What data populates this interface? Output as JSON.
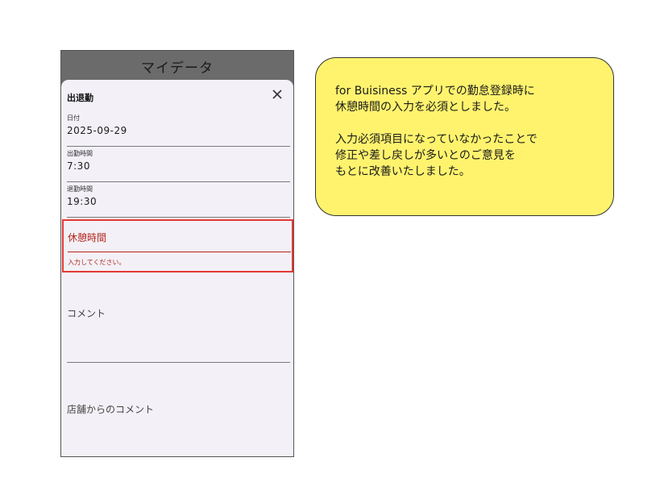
{
  "header": {
    "title": "マイデータ"
  },
  "sheet": {
    "title": "出退勤",
    "fields": {
      "date": {
        "label": "日付",
        "value": "2025-09-29"
      },
      "start": {
        "label": "出勤時間",
        "value": "7:30"
      },
      "end": {
        "label": "退勤時間",
        "value": "19:30"
      }
    },
    "break_time": {
      "label": "休憩時間",
      "error": "入力してください。"
    },
    "comment_label": "コメント",
    "store_comment_label": "店舗からのコメント"
  },
  "note": {
    "lines_1": [
      "for Buisiness アプリでの勤怠登録時に",
      "休憩時間の入力を必須としました。"
    ],
    "lines_2": [
      "入力必須項目になっていなかったことで",
      "修正や差し戻しが多いとのご意見を",
      "もとに改善いたしました。"
    ]
  },
  "colors": {
    "error_red": "#e53935",
    "note_yellow": "#fff36e",
    "header_gray": "#6b6b6b"
  }
}
